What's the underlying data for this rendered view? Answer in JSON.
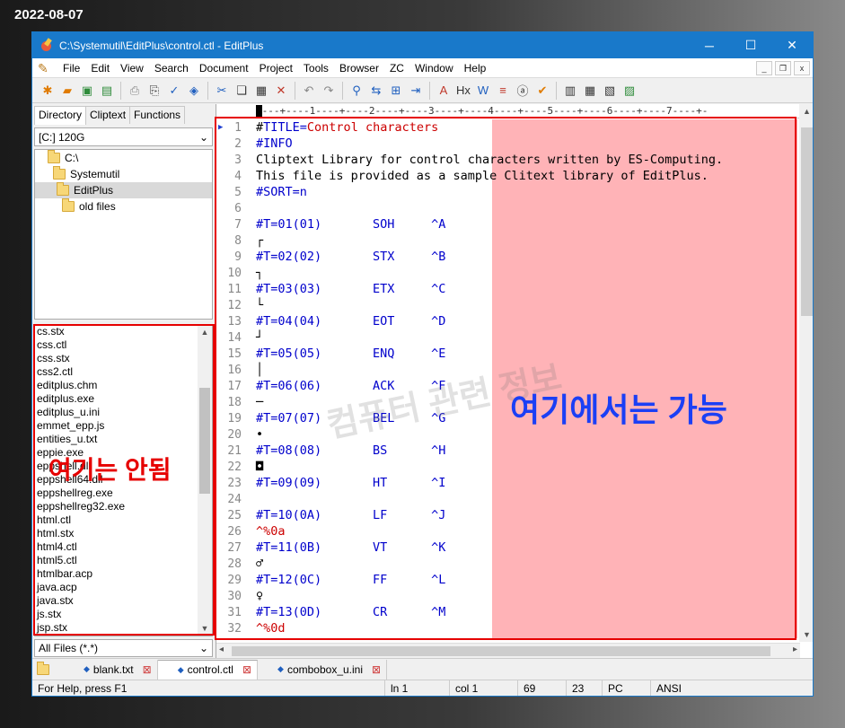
{
  "date_label": "2022-08-07",
  "window": {
    "title": "C:\\Systemutil\\EditPlus\\control.ctl - EditPlus",
    "minimize": "─",
    "maximize": "☐",
    "close": "✕"
  },
  "menu": {
    "items": [
      "File",
      "Edit",
      "View",
      "Search",
      "Document",
      "Project",
      "Tools",
      "Browser",
      "ZC",
      "Window",
      "Help"
    ],
    "mdi_min": "_",
    "mdi_restore": "❐",
    "mdi_close": "x"
  },
  "left_tabs": [
    "Directory",
    "Cliptext",
    "Functions"
  ],
  "drive": "[C:] 120G",
  "dir_tree": [
    "C:\\",
    "Systemutil",
    "EditPlus",
    "old files"
  ],
  "files": [
    "cs.stx",
    "css.ctl",
    "css.stx",
    "css2.ctl",
    "editplus.chm",
    "editplus.exe",
    "editplus_u.ini",
    "emmet_epp.js",
    "entities_u.txt",
    "eppie.exe",
    "eppshell.dll",
    "eppshell64.dll",
    "eppshellreg.exe",
    "eppshellreg32.exe",
    "html.ctl",
    "html.stx",
    "html4.ctl",
    "html5.ctl",
    "htmlbar.acp",
    "java.acp",
    "java.stx",
    "js.stx",
    "jsp.stx"
  ],
  "file_filter": "All Files (*.*)",
  "ruler": "---+----1----+----2----+----3----+----4----+----5----+----6----+----7----+-",
  "code_lines": [
    {
      "n": "1",
      "segs": [
        {
          "t": "#",
          "c": "t-black"
        },
        {
          "t": "TITLE=",
          "c": "t-blue"
        },
        {
          "t": "Control characters",
          "c": "t-red"
        }
      ]
    },
    {
      "n": "2",
      "segs": [
        {
          "t": "#INFO",
          "c": "t-blue"
        }
      ]
    },
    {
      "n": "3",
      "segs": [
        {
          "t": "Cliptext Library for control characters written by ES-Computing.",
          "c": "t-black"
        }
      ]
    },
    {
      "n": "4",
      "segs": [
        {
          "t": "This file is provided as a sample Clitext library of EditPlus.",
          "c": "t-black"
        }
      ]
    },
    {
      "n": "5",
      "segs": [
        {
          "t": "#SORT=n",
          "c": "t-blue"
        }
      ]
    },
    {
      "n": "6",
      "segs": []
    },
    {
      "n": "7",
      "segs": [
        {
          "t": "#T=01(01)       SOH     ^A",
          "c": "t-blue"
        }
      ]
    },
    {
      "n": "8",
      "segs": [
        {
          "t": "┌",
          "c": "t-black"
        }
      ]
    },
    {
      "n": "9",
      "segs": [
        {
          "t": "#T=02(02)       STX     ^B",
          "c": "t-blue"
        }
      ]
    },
    {
      "n": "10",
      "segs": [
        {
          "t": "┐",
          "c": "t-black"
        }
      ]
    },
    {
      "n": "11",
      "segs": [
        {
          "t": "#T=03(03)       ETX     ^C",
          "c": "t-blue"
        }
      ]
    },
    {
      "n": "12",
      "segs": [
        {
          "t": "└",
          "c": "t-black"
        }
      ]
    },
    {
      "n": "13",
      "segs": [
        {
          "t": "#T=04(04)       EOT     ^D",
          "c": "t-blue"
        }
      ]
    },
    {
      "n": "14",
      "segs": [
        {
          "t": "┘",
          "c": "t-black"
        }
      ]
    },
    {
      "n": "15",
      "segs": [
        {
          "t": "#T=05(05)       ENQ     ^E",
          "c": "t-blue"
        }
      ]
    },
    {
      "n": "16",
      "segs": [
        {
          "t": "│",
          "c": "t-black"
        }
      ]
    },
    {
      "n": "17",
      "segs": [
        {
          "t": "#T=06(06)       ACK     ^F",
          "c": "t-blue"
        }
      ]
    },
    {
      "n": "18",
      "segs": [
        {
          "t": "─",
          "c": "t-black"
        }
      ]
    },
    {
      "n": "19",
      "segs": [
        {
          "t": "#T=07(07)       BEL     ^G",
          "c": "t-blue"
        }
      ]
    },
    {
      "n": "20",
      "segs": [
        {
          "t": "•",
          "c": "t-black"
        }
      ]
    },
    {
      "n": "21",
      "segs": [
        {
          "t": "#T=08(08)       BS      ^H",
          "c": "t-blue"
        }
      ]
    },
    {
      "n": "22",
      "segs": [
        {
          "t": "◘",
          "c": "t-black"
        }
      ]
    },
    {
      "n": "23",
      "segs": [
        {
          "t": "#T=09(09)       HT      ^I",
          "c": "t-blue"
        }
      ]
    },
    {
      "n": "24",
      "segs": []
    },
    {
      "n": "25",
      "segs": [
        {
          "t": "#T=10(0A)       LF      ^J",
          "c": "t-blue"
        }
      ]
    },
    {
      "n": "26",
      "segs": [
        {
          "t": "^%0a",
          "c": "t-red"
        }
      ]
    },
    {
      "n": "27",
      "segs": [
        {
          "t": "#T=11(0B)       VT      ^K",
          "c": "t-blue"
        }
      ]
    },
    {
      "n": "28",
      "segs": [
        {
          "t": "♂",
          "c": "t-black"
        }
      ]
    },
    {
      "n": "29",
      "segs": [
        {
          "t": "#T=12(0C)       FF      ^L",
          "c": "t-blue"
        }
      ]
    },
    {
      "n": "30",
      "segs": [
        {
          "t": "♀",
          "c": "t-black"
        }
      ]
    },
    {
      "n": "31",
      "segs": [
        {
          "t": "#T=13(0D)       CR      ^M",
          "c": "t-blue"
        }
      ]
    },
    {
      "n": "32",
      "segs": [
        {
          "t": "^%0d",
          "c": "t-red"
        }
      ]
    }
  ],
  "watermark": "컴퓨터 관련 정보",
  "overlay_left": "여기는 안됨",
  "overlay_right": "여기에서는 가능",
  "doc_tabs": [
    {
      "label": "blank.txt",
      "active": false
    },
    {
      "label": "control.ctl",
      "active": true
    },
    {
      "label": "combobox_u.ini",
      "active": false
    }
  ],
  "status": {
    "help": "For Help, press F1",
    "line": "ln 1",
    "col": "col 1",
    "total_lines": "69",
    "chars": "23",
    "mode": "PC",
    "encoding": "ANSI"
  },
  "colors": {
    "accent": "#1979ca",
    "highlight_pink": "#ffb3b7",
    "annotation_red": "#e60000",
    "annotation_blue": "#1b3ff5"
  }
}
